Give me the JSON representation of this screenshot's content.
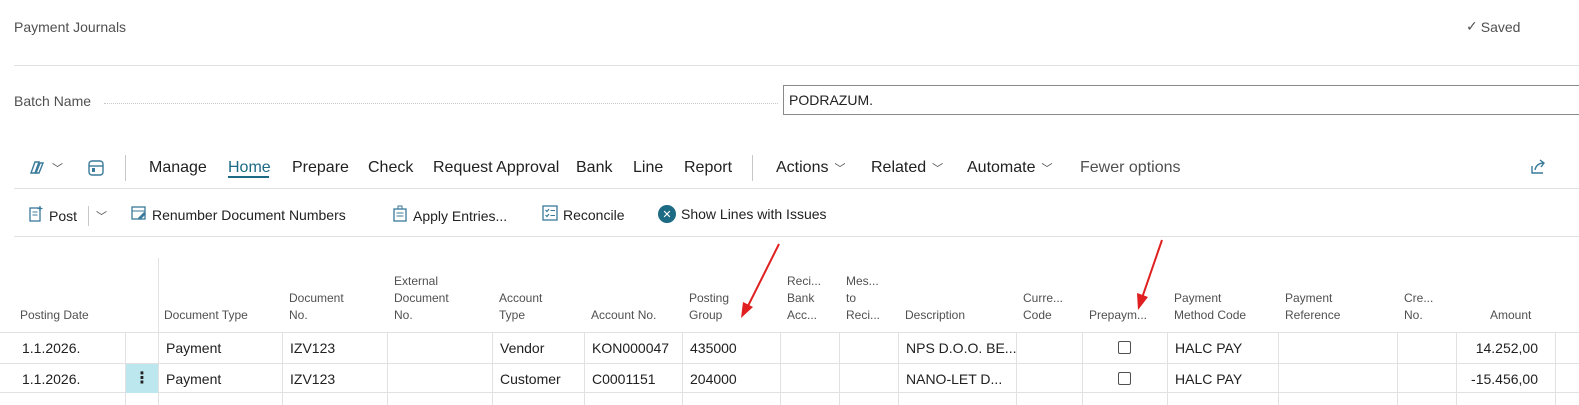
{
  "page": {
    "title": "Payment Journals",
    "saved_label": "Saved",
    "batch_label": "Batch Name",
    "batch_value": "PODRAZUM."
  },
  "actionbar": {
    "items": [
      "Manage",
      "Home",
      "Prepare",
      "Check",
      "Request Approval",
      "Bank",
      "Line",
      "Report"
    ],
    "menus": [
      "Actions",
      "Related",
      "Automate"
    ],
    "fewer_options": "Fewer options",
    "active": "Home"
  },
  "toolbar": {
    "post": "Post",
    "renumber": "Renumber Document Numbers",
    "apply_entries": "Apply Entries...",
    "reconcile": "Reconcile",
    "show_issues": "Show Lines with Issues"
  },
  "columns": {
    "posting_date": "Posting Date",
    "document_type": "Document Type",
    "document_no_1": "Document",
    "document_no_2": "No.",
    "external_1": "External",
    "external_2": "Document",
    "external_3": "No.",
    "account_type_1": "Account",
    "account_type_2": "Type",
    "account_no": "Account No.",
    "posting_group_1": "Posting",
    "posting_group_2": "Group",
    "reci_bank_1": "Reci...",
    "reci_bank_2": "Bank",
    "reci_bank_3": "Acc...",
    "mes_1": "Mes...",
    "mes_2": "to",
    "mes_3": "Reci...",
    "description": "Description",
    "currency_1": "Curre...",
    "currency_2": "Code",
    "prepayment": "Prepaym...",
    "payment_method_1": "Payment",
    "payment_method_2": "Method Code",
    "payment_ref_1": "Payment",
    "payment_ref_2": "Reference",
    "cre_1": "Cre...",
    "cre_2": "No.",
    "amount": "Amount"
  },
  "rows": [
    {
      "posting_date": "1.1.2026.",
      "document_type": "Payment",
      "document_no": "IZV123",
      "account_type": "Vendor",
      "account_no": "KON000047",
      "posting_group": "435000",
      "description": "NPS D.O.O. BE...",
      "prepayment": false,
      "payment_method": "HALC PAY",
      "amount": "14.252,00"
    },
    {
      "posting_date": "1.1.2026.",
      "document_type": "Payment",
      "document_no": "IZV123",
      "account_type": "Customer",
      "account_no": "C0001151",
      "posting_group": "204000",
      "description": "NANO-LET D...",
      "prepayment": false,
      "payment_method": "HALC PAY",
      "amount": "-15.456,00"
    }
  ],
  "colors": {
    "accent": "#1c6a84",
    "selected_row_handle": "#bde7ef",
    "annotation_arrow": "#e02020"
  },
  "icons": [
    "checkmark-icon",
    "copilot-icon",
    "chevron-down-icon",
    "filter-pane-icon",
    "post-icon",
    "renumber-icon",
    "apply-entries-icon",
    "reconcile-icon",
    "issues-icon",
    "share-icon",
    "kebab-icon"
  ]
}
